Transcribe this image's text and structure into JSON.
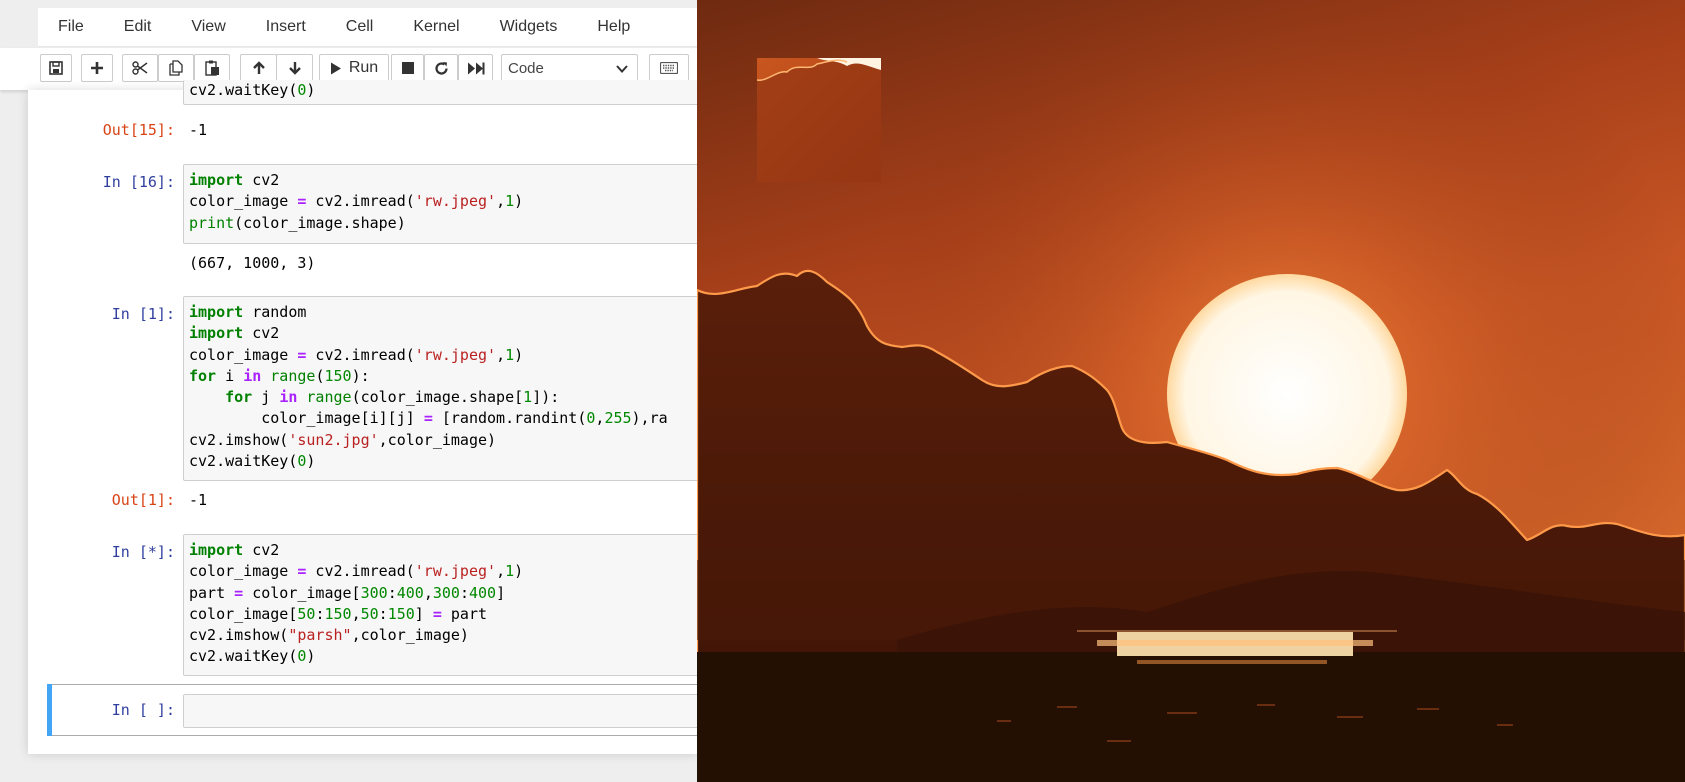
{
  "menubar": {
    "items": [
      "File",
      "Edit",
      "View",
      "Insert",
      "Cell",
      "Kernel",
      "Widgets",
      "Help"
    ]
  },
  "toolbar": {
    "run_label": "Run",
    "cell_type_value": "Code",
    "icons": [
      "save-icon",
      "plus-icon",
      "cut-icon",
      "copy-icon",
      "paste-icon",
      "arrow-up-icon",
      "arrow-down-icon",
      "run-icon",
      "stop-icon",
      "restart-icon",
      "fast-forward-icon",
      "keyboard-icon"
    ]
  },
  "cells": {
    "c15": {
      "partial_line": "cv2.waitKey(0)",
      "out_prompt": "Out[15]:",
      "output": "-1"
    },
    "c16": {
      "in_prompt": "In [16]:",
      "output": "(667, 1000, 3)"
    },
    "c1": {
      "in_prompt": "In [1]:",
      "out_prompt": "Out[1]:",
      "output": "-1"
    },
    "cstar": {
      "in_prompt": "In [*]:"
    },
    "cempty": {
      "in_prompt": "In [ ]:"
    }
  },
  "colors": {
    "in_prompt": "#303f9f",
    "out_prompt": "#d84315",
    "keyword": "#008000",
    "string": "#ba2121",
    "active_cell": "#42a5f5",
    "sky_top": "#7a2d0e",
    "sun": "#fff8ea"
  }
}
